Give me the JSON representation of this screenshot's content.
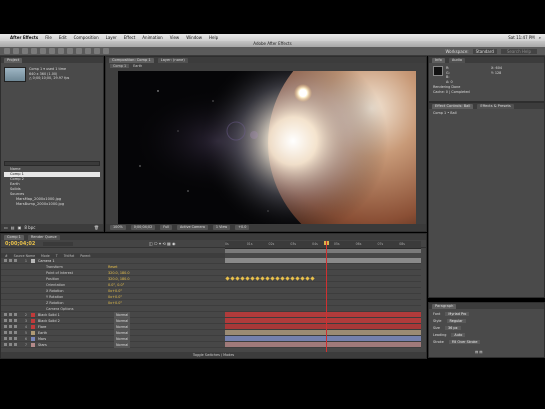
{
  "menubar": {
    "app_name": "After Effects",
    "items": [
      "File",
      "Edit",
      "Composition",
      "Layer",
      "Effect",
      "Animation",
      "View",
      "Window",
      "Help"
    ],
    "clock": "Sat 11:47 PM"
  },
  "window_title": "Adobe After Effects",
  "toolbar": {
    "workspace_label": "Workspace:",
    "workspace_value": "Standard",
    "search_placeholder": "Search Help"
  },
  "project": {
    "tab": "Project",
    "info_lines": [
      "Comp 1 ▾ used 1 time",
      "640 x 360 (1.00)",
      "△ 0;00;10;00, 29.97 fps"
    ],
    "search_placeholder": "",
    "items": [
      {
        "label": "Name",
        "selected": false,
        "indent": false
      },
      {
        "label": "Comp 1",
        "selected": true,
        "indent": false
      },
      {
        "label": "Comp 2",
        "selected": false,
        "indent": false
      },
      {
        "label": "Earth",
        "selected": false,
        "indent": false
      },
      {
        "label": "Solids",
        "selected": false,
        "indent": false
      },
      {
        "label": "Sources",
        "selected": false,
        "indent": false
      },
      {
        "label": "MarsMap_2000x1000.jpg",
        "selected": false,
        "indent": true
      },
      {
        "label": "MarsBump_2000x1000.jpg",
        "selected": false,
        "indent": true
      }
    ],
    "footer_bpc": "8 bpc"
  },
  "viewer": {
    "tabs": [
      "Composition: Comp 1",
      "Layer: (none)"
    ],
    "crumbs": [
      "Comp 1",
      "Earth"
    ],
    "footer": [
      "100%",
      "0;00;04;02",
      "Full",
      "Active Camera",
      "1 View",
      "+0.0"
    ]
  },
  "info": {
    "tabs": [
      "Info",
      "Audio"
    ],
    "lines": [
      "R:",
      "G:",
      "B:",
      "A: 0"
    ],
    "coords": [
      "X: 604",
      "Y: 128"
    ],
    "rendering_title": "Rendering Done",
    "rendering_detail": "Cache: 0 | Completed"
  },
  "effects": {
    "tabs": [
      "Effect Controls: Ball",
      "Effects & Presets"
    ],
    "sub": "Comp 1 • Ball"
  },
  "paragraph": {
    "tab": "Paragraph",
    "rows": [
      {
        "label": "Font",
        "value": "Myriad Pro"
      },
      {
        "label": "Style",
        "value": "Regular"
      },
      {
        "label": "Size",
        "value": "36 px"
      },
      {
        "label": "Leading",
        "value": "Auto"
      },
      {
        "label": "Stroke",
        "value": "Fill Over Stroke"
      }
    ]
  },
  "timeline": {
    "tabs": [
      "Comp 1",
      "Render Queue"
    ],
    "timecode": "0;00;04;02",
    "ruler_ticks": [
      "0s",
      "01s",
      "02s",
      "03s",
      "04s",
      "05s",
      "06s",
      "07s",
      "08s"
    ],
    "columns": [
      "#",
      "Source Name",
      "Mode",
      "T",
      "TrkMat",
      "Parent"
    ],
    "layers": [
      {
        "num": "1",
        "name": "Camera 1",
        "color": "#b8b8b8",
        "value": "",
        "sub": false,
        "track": "#8a8a8a"
      },
      {
        "num": "",
        "name": "Transform",
        "color": "",
        "value": "Reset",
        "sub": true,
        "track": ""
      },
      {
        "num": "",
        "name": "Point of Interest",
        "color": "",
        "value": "320.0, 180.0",
        "sub": true,
        "track": ""
      },
      {
        "num": "",
        "name": "Position",
        "color": "",
        "value": "320.0, 180.0",
        "sub": true,
        "track": "kf"
      },
      {
        "num": "",
        "name": "Orientation",
        "color": "",
        "value": "0.0°, 0.0°",
        "sub": true,
        "track": ""
      },
      {
        "num": "",
        "name": "X Rotation",
        "color": "",
        "value": "0x+0.0°",
        "sub": true,
        "track": ""
      },
      {
        "num": "",
        "name": "Y Rotation",
        "color": "",
        "value": "0x+0.0°",
        "sub": true,
        "track": ""
      },
      {
        "num": "",
        "name": "Z Rotation",
        "color": "",
        "value": "0x+0.0°",
        "sub": true,
        "track": ""
      },
      {
        "num": "",
        "name": "Camera Options",
        "color": "",
        "value": "",
        "sub": true,
        "track": ""
      },
      {
        "num": "2",
        "name": "Black Solid 1",
        "color": "#c03a3a",
        "value": "Normal",
        "sub": false,
        "track": "#b03b3b"
      },
      {
        "num": "3",
        "name": "Black Solid 2",
        "color": "#c03a3a",
        "value": "Normal",
        "sub": false,
        "track": "#b03b3b"
      },
      {
        "num": "4",
        "name": "Flare",
        "color": "#c03a3a",
        "value": "Normal",
        "sub": false,
        "track": "#a83838"
      },
      {
        "num": "5",
        "name": "Earth",
        "color": "#b09a74",
        "value": "Normal",
        "sub": false,
        "track": "#9b8b74"
      },
      {
        "num": "6",
        "name": "Mars",
        "color": "#7a86b8",
        "value": "Normal",
        "sub": false,
        "track": "#7480ad"
      },
      {
        "num": "7",
        "name": "Stars",
        "color": "#b48a8a",
        "value": "Normal",
        "sub": false,
        "track": "#a07a7a"
      }
    ],
    "footer": "Toggle Switches / Modes"
  },
  "colors": {
    "keyframe": "#e8c04a",
    "playhead": "#d03030"
  }
}
